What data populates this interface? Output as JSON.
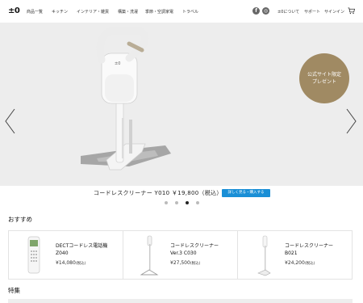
{
  "header": {
    "logo": "±0",
    "nav": [
      "商品一覧",
      "キッチン",
      "インテリア・雑貨",
      "構築・洗濯",
      "季節・空調家電",
      "トラベル"
    ],
    "sns": {
      "facebook": "f",
      "instagram": "◎"
    },
    "util": [
      "±0について",
      "サポート",
      "サインイン"
    ],
    "cart_icon": "cart-icon"
  },
  "hero": {
    "badge_line1": "公式サイト限定",
    "badge_line2": "プレゼント",
    "badge_color": "#a08a63",
    "caption_title": "コードレスクリーナー Y010 ￥19,800（税込）",
    "caption_button": "詳しく見る・購入する",
    "button_color": "#1a8fd6",
    "slide_count": 4,
    "active_slide": 3
  },
  "recommend": {
    "title": "おすすめ",
    "items": [
      {
        "name_line1": "DECTコードレス電話機",
        "name_line2": "Z040",
        "price": "¥14,080",
        "tax": "(税込)"
      },
      {
        "name_line1": "コードレスクリーナー",
        "name_line2": "Ver.3 C030",
        "price": "¥27,500",
        "tax": "(税込)"
      },
      {
        "name_line1": "コードレスクリーナー",
        "name_line2": "B021",
        "price": "¥24,200",
        "tax": "(税込)"
      }
    ]
  },
  "feature": {
    "title": "特集"
  }
}
